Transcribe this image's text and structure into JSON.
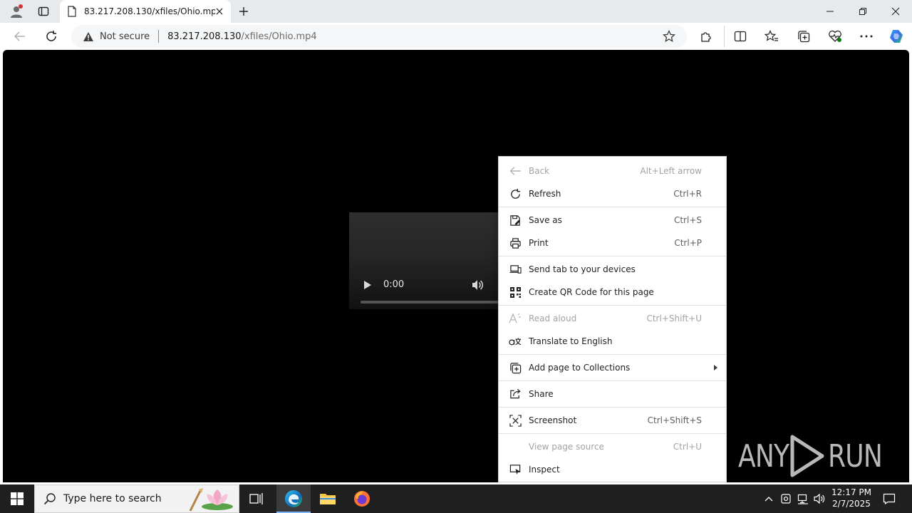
{
  "browser": {
    "tab_title": "83.217.208.130/xfiles/Ohio.mp4",
    "security_label": "Not secure",
    "url_host": "83.217.208.130",
    "url_path": "/xfiles/Ohio.mp4"
  },
  "video": {
    "time": "0:00"
  },
  "context_menu": {
    "items": [
      {
        "label": "Back",
        "shortcut": "Alt+Left arrow",
        "icon": "back-arrow-icon",
        "disabled": true
      },
      {
        "label": "Refresh",
        "shortcut": "Ctrl+R",
        "icon": "refresh-icon",
        "disabled": false
      },
      {
        "label": "Save as",
        "shortcut": "Ctrl+S",
        "icon": "save-as-icon",
        "disabled": false
      },
      {
        "label": "Print",
        "shortcut": "Ctrl+P",
        "icon": "print-icon",
        "disabled": false
      },
      {
        "label": "Send tab to your devices",
        "shortcut": "",
        "icon": "send-tab-icon",
        "disabled": false
      },
      {
        "label": "Create QR Code for this page",
        "shortcut": "",
        "icon": "qr-code-icon",
        "disabled": false
      },
      {
        "label": "Read aloud",
        "shortcut": "Ctrl+Shift+U",
        "icon": "read-aloud-icon",
        "disabled": true
      },
      {
        "label": "Translate to English",
        "shortcut": "",
        "icon": "translate-icon",
        "disabled": false
      },
      {
        "label": "Add page to Collections",
        "shortcut": "",
        "icon": "collections-icon",
        "disabled": false,
        "submenu": true
      },
      {
        "label": "Share",
        "shortcut": "",
        "icon": "share-icon",
        "disabled": false
      },
      {
        "label": "Screenshot",
        "shortcut": "Ctrl+Shift+S",
        "icon": "screenshot-icon",
        "disabled": false
      },
      {
        "label": "View page source",
        "shortcut": "Ctrl+U",
        "icon": "",
        "disabled": true
      },
      {
        "label": "Inspect",
        "shortcut": "",
        "icon": "inspect-icon",
        "disabled": false
      }
    ]
  },
  "watermark": {
    "left": "ANY",
    "right": "RUN"
  },
  "taskbar": {
    "search_placeholder": "Type here to search",
    "time": "12:17 PM",
    "date": "2/7/2025"
  },
  "colors": {
    "tabstrip_bg": "#e7eaed",
    "page_bg": "#000000",
    "taskbar_bg": "#1f1f1f",
    "edge_accent": "#0f6cbd"
  }
}
